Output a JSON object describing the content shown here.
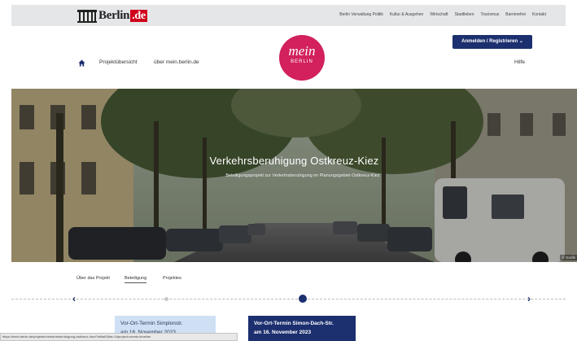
{
  "topbar": {
    "logo_prefix": "Berlin",
    "logo_suffix": ".de",
    "links": [
      "Berlin Verwaltung Politik",
      "Kultur & Ausgehen",
      "Wirtschaft",
      "Stadtleben",
      "Tourismus",
      "Barrierefrei",
      "Kontakt"
    ]
  },
  "header": {
    "logo_mein": "mein",
    "logo_berlin": "BERLIN",
    "login_label": "Anmelden / Registrieren ⌄",
    "nav_projects": "Projektübersicht",
    "nav_about": "über mein.berlin.de",
    "help": "Hilfe"
  },
  "hero": {
    "title": "Verkehrsberuhigung Ostkreuz-Kiez",
    "subtitle": "Beteiligungsprojekt zur Verkehrsberuhigung im Planungsgebiet Ostkreuz-Kiez",
    "credit": "© Grafik"
  },
  "tabs": [
    {
      "label": "Über das Projekt"
    },
    {
      "label": "Beteiligung"
    },
    {
      "label": "Projektes"
    }
  ],
  "timeline": {
    "prev_label": "‹",
    "next_label": "›"
  },
  "events": [
    {
      "title": "Vor-Ort-Termin Simplonstr.",
      "date": "am 16. November 2023"
    },
    {
      "title": "Vor-Ort-Termin Simon-Dach-Str.",
      "date": "am 16. November 2023"
    }
  ],
  "status_url": "https://mein.berlin.de/projekte/verkehrsberuhigung-ostkreuz-kiez/?initialSlide=1#project-events-timeline",
  "colors": {
    "brand_navy": "#1c2f6e",
    "mein_pink": "#d2215d",
    "berlin_red": "#d0021b",
    "card_light": "#cfe0f5"
  }
}
